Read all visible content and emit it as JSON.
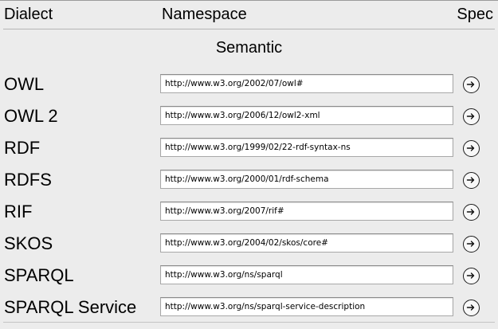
{
  "header": {
    "dialect_label": "Dialect",
    "namespace_label": "Namespace",
    "spec_label": "Spec"
  },
  "section": {
    "title": "Semantic"
  },
  "rows": [
    {
      "dialect": "OWL",
      "namespace": "http://www.w3.org/2002/07/owl#",
      "icon": "arrow-right-circle-icon"
    },
    {
      "dialect": "OWL 2",
      "namespace": "http://www.w3.org/2006/12/owl2-xml",
      "icon": "arrow-right-circle-icon"
    },
    {
      "dialect": "RDF",
      "namespace": "http://www.w3.org/1999/02/22-rdf-syntax-ns",
      "icon": "arrow-right-circle-icon"
    },
    {
      "dialect": "RDFS",
      "namespace": "http://www.w3.org/2000/01/rdf-schema",
      "icon": "arrow-right-circle-icon"
    },
    {
      "dialect": "RIF",
      "namespace": "http://www.w3.org/2007/rif#",
      "icon": "arrow-right-circle-icon"
    },
    {
      "dialect": "SKOS",
      "namespace": "http://www.w3.org/2004/02/skos/core#",
      "icon": "arrow-right-circle-icon"
    },
    {
      "dialect": "SPARQL",
      "namespace": "http://www.w3.org/ns/sparql",
      "icon": "arrow-right-circle-icon"
    },
    {
      "dialect": "SPARQL Service",
      "namespace": "http://www.w3.org/ns/sparql-service-description",
      "icon": "arrow-right-circle-icon"
    }
  ],
  "colors": {
    "background": "#ececec",
    "field_background": "#ffffff",
    "field_border": "#a8a8a8",
    "text": "#000000"
  }
}
